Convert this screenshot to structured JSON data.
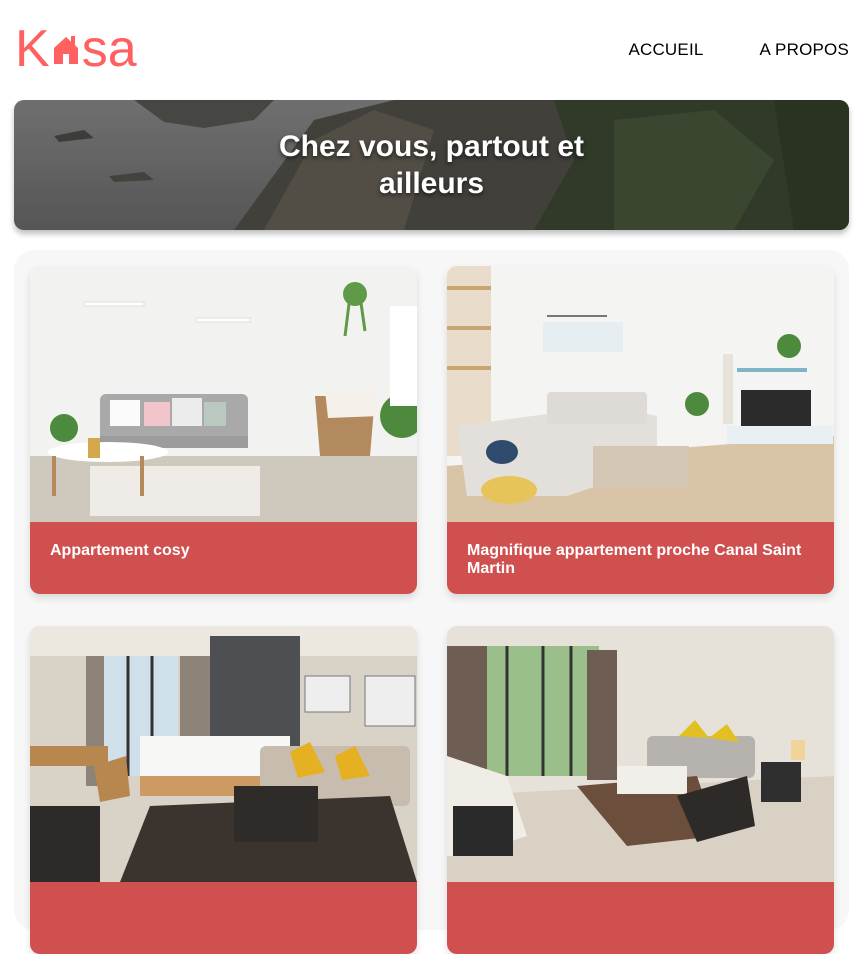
{
  "logo": {
    "text_before": "K",
    "text_after": "sa",
    "color": "#FF6060"
  },
  "nav": {
    "items": [
      {
        "label": "ACCUEIL"
      },
      {
        "label": "A PROPOS"
      }
    ]
  },
  "banner": {
    "title": "Chez vous, partout et ailleurs",
    "title_line1": "Chez vous, partout et",
    "title_line2": "ailleurs"
  },
  "listings": [
    {
      "title": "Appartement cosy"
    },
    {
      "title": "Magnifique appartement proche Canal Saint Martin"
    },
    {
      "title": ""
    },
    {
      "title": ""
    }
  ],
  "colors": {
    "accent": "#FF6060",
    "card": "#D05050",
    "gallery_bg": "#F7F7F7"
  }
}
